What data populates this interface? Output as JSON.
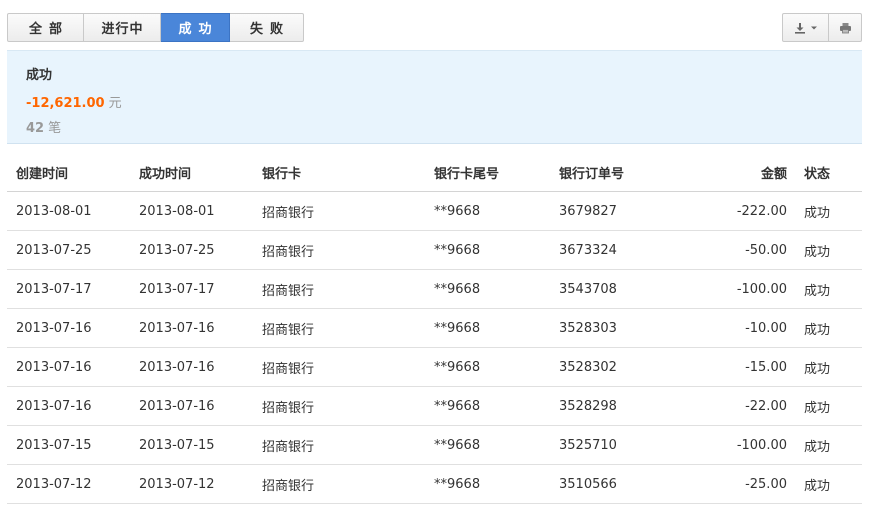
{
  "tabs": [
    {
      "label": "全部",
      "active": false
    },
    {
      "label": "进行中",
      "active": false
    },
    {
      "label": "成功",
      "active": true
    },
    {
      "label": "失败",
      "active": false
    }
  ],
  "toolbar": {
    "export_icon": "download-icon",
    "dropdown_icon": "caret-down-icon",
    "print_icon": "printer-icon"
  },
  "summary": {
    "title": "成功",
    "amount": "-12,621.00",
    "amount_unit": "元",
    "count": "42",
    "count_unit": "笔"
  },
  "colors": {
    "accent": "#4a86d9",
    "amount": "#ff6600",
    "summary_bg": "#e8f4fd"
  },
  "table": {
    "headers": [
      "创建时间",
      "成功时间",
      "银行卡",
      "银行卡尾号",
      "银行订单号",
      "金额",
      "状态"
    ],
    "rows": [
      [
        "2013-08-01",
        "2013-08-01",
        "招商银行",
        "**9668",
        "3679827",
        "-222.00",
        "成功"
      ],
      [
        "2013-07-25",
        "2013-07-25",
        "招商银行",
        "**9668",
        "3673324",
        "-50.00",
        "成功"
      ],
      [
        "2013-07-17",
        "2013-07-17",
        "招商银行",
        "**9668",
        "3543708",
        "-100.00",
        "成功"
      ],
      [
        "2013-07-16",
        "2013-07-16",
        "招商银行",
        "**9668",
        "3528303",
        "-10.00",
        "成功"
      ],
      [
        "2013-07-16",
        "2013-07-16",
        "招商银行",
        "**9668",
        "3528302",
        "-15.00",
        "成功"
      ],
      [
        "2013-07-16",
        "2013-07-16",
        "招商银行",
        "**9668",
        "3528298",
        "-22.00",
        "成功"
      ],
      [
        "2013-07-15",
        "2013-07-15",
        "招商银行",
        "**9668",
        "3525710",
        "-100.00",
        "成功"
      ],
      [
        "2013-07-12",
        "2013-07-12",
        "招商银行",
        "**9668",
        "3510566",
        "-25.00",
        "成功"
      ]
    ]
  }
}
